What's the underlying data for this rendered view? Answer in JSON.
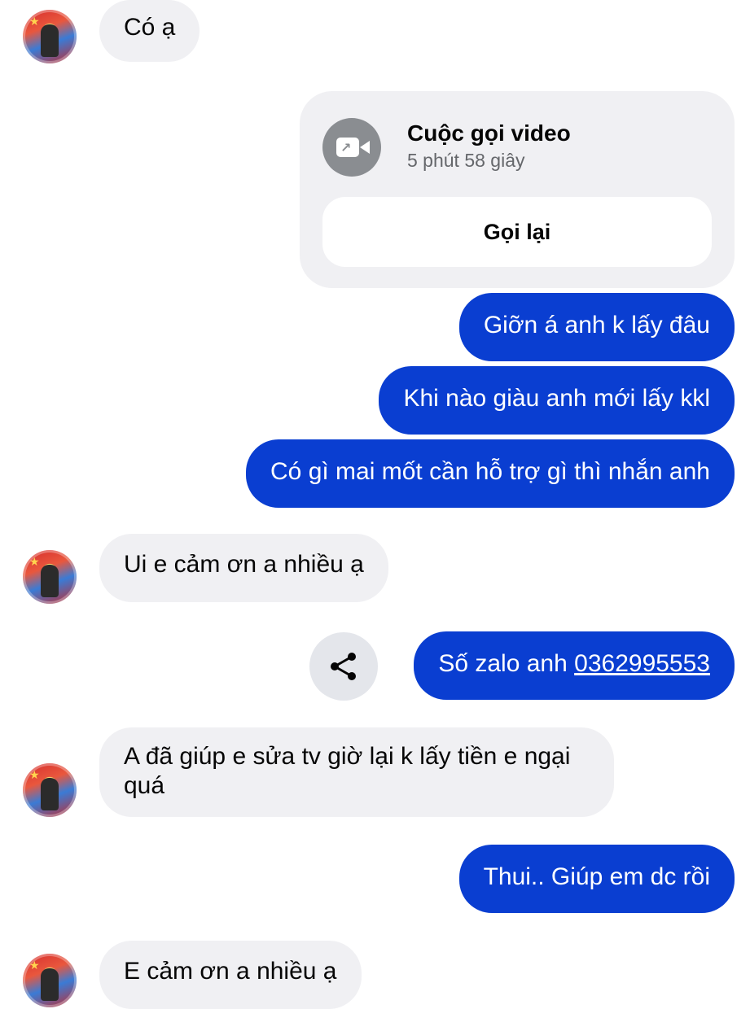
{
  "thread": {
    "messages": [
      {
        "type": "incoming",
        "text": "Có ạ"
      },
      {
        "type": "call",
        "title": "Cuộc gọi video",
        "duration": "5 phút 58 giây",
        "action": "Gọi lại"
      },
      {
        "type": "outgoing",
        "text": "Giỡn á anh k lấy đâu"
      },
      {
        "type": "outgoing",
        "text": "Khi nào giàu anh mới lấy kkl"
      },
      {
        "type": "outgoing",
        "text": "Có gì mai mốt cần hỗ trợ gì thì nhắn anh"
      },
      {
        "type": "incoming",
        "text": "Ui e cảm ơn a nhiều ạ"
      },
      {
        "type": "outgoing",
        "text_prefix": "Số zalo anh ",
        "link": "0362995553"
      },
      {
        "type": "incoming",
        "text_line1": "A đã giúp e sửa tv giờ lại k lấy tiền e ngại",
        "text_line2": "quá"
      },
      {
        "type": "outgoing",
        "text": "Thui.. Giúp em dc rồi"
      },
      {
        "type": "incoming",
        "text": "E cảm ơn a nhiều ạ"
      }
    ]
  },
  "icons": {
    "call": "video-call-icon",
    "share": "share-icon",
    "avatar": "contact-avatar"
  },
  "colors": {
    "outgoing_bubble": "#0a3ed1",
    "incoming_bubble": "#f0f0f3"
  }
}
